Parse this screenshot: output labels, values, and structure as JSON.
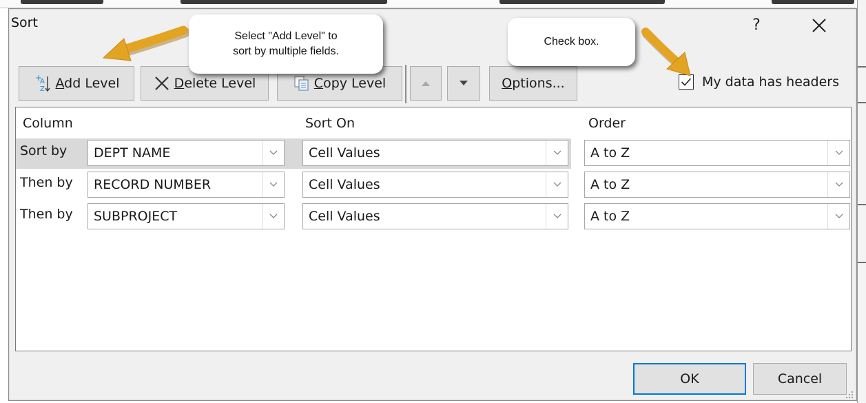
{
  "dialog": {
    "title": "Sort",
    "help_label": "?"
  },
  "toolbar": {
    "add_level": {
      "prefix": "",
      "accel": "A",
      "rest": "dd Level"
    },
    "delete_level": {
      "accel": "D",
      "rest": "elete Level"
    },
    "copy_level": {
      "accel": "C",
      "rest": "opy Level"
    },
    "options": {
      "accel": "O",
      "rest": "ptions..."
    },
    "headers_checkbox": {
      "before": "My data has ",
      "accel": "h",
      "after": "eaders",
      "checked": true
    }
  },
  "grid": {
    "headers": {
      "column": "Column",
      "sort_on": "Sort On",
      "order": "Order"
    },
    "rows": [
      {
        "label": "Sort by",
        "column": "DEPT NAME",
        "sort_on": "Cell Values",
        "order": "A to Z"
      },
      {
        "label": "Then by",
        "column": "RECORD NUMBER",
        "sort_on": "Cell Values",
        "order": "A to Z"
      },
      {
        "label": "Then by",
        "column": "SUBPROJECT",
        "sort_on": "Cell Values",
        "order": "A to Z"
      }
    ]
  },
  "footer": {
    "ok": "OK",
    "cancel": "Cancel"
  },
  "callouts": {
    "add_level_line1": "Select \"Add Level\" to",
    "add_level_line2": "sort by multiple fields.",
    "checkbox": "Check box."
  },
  "colors": {
    "dialog_bg": "#f0f0f0",
    "button_bg": "#e1e1e1",
    "default_button_border": "#0078d7",
    "arrow": "#e3a424",
    "selected_row": "#d9d9d9"
  },
  "icons": [
    "add-level-icon",
    "delete-x-icon",
    "copy-level-icon",
    "move-up-icon",
    "move-down-icon",
    "close-icon",
    "checkmark-icon",
    "chevron-down-icon",
    "resize-grip-icon"
  ]
}
